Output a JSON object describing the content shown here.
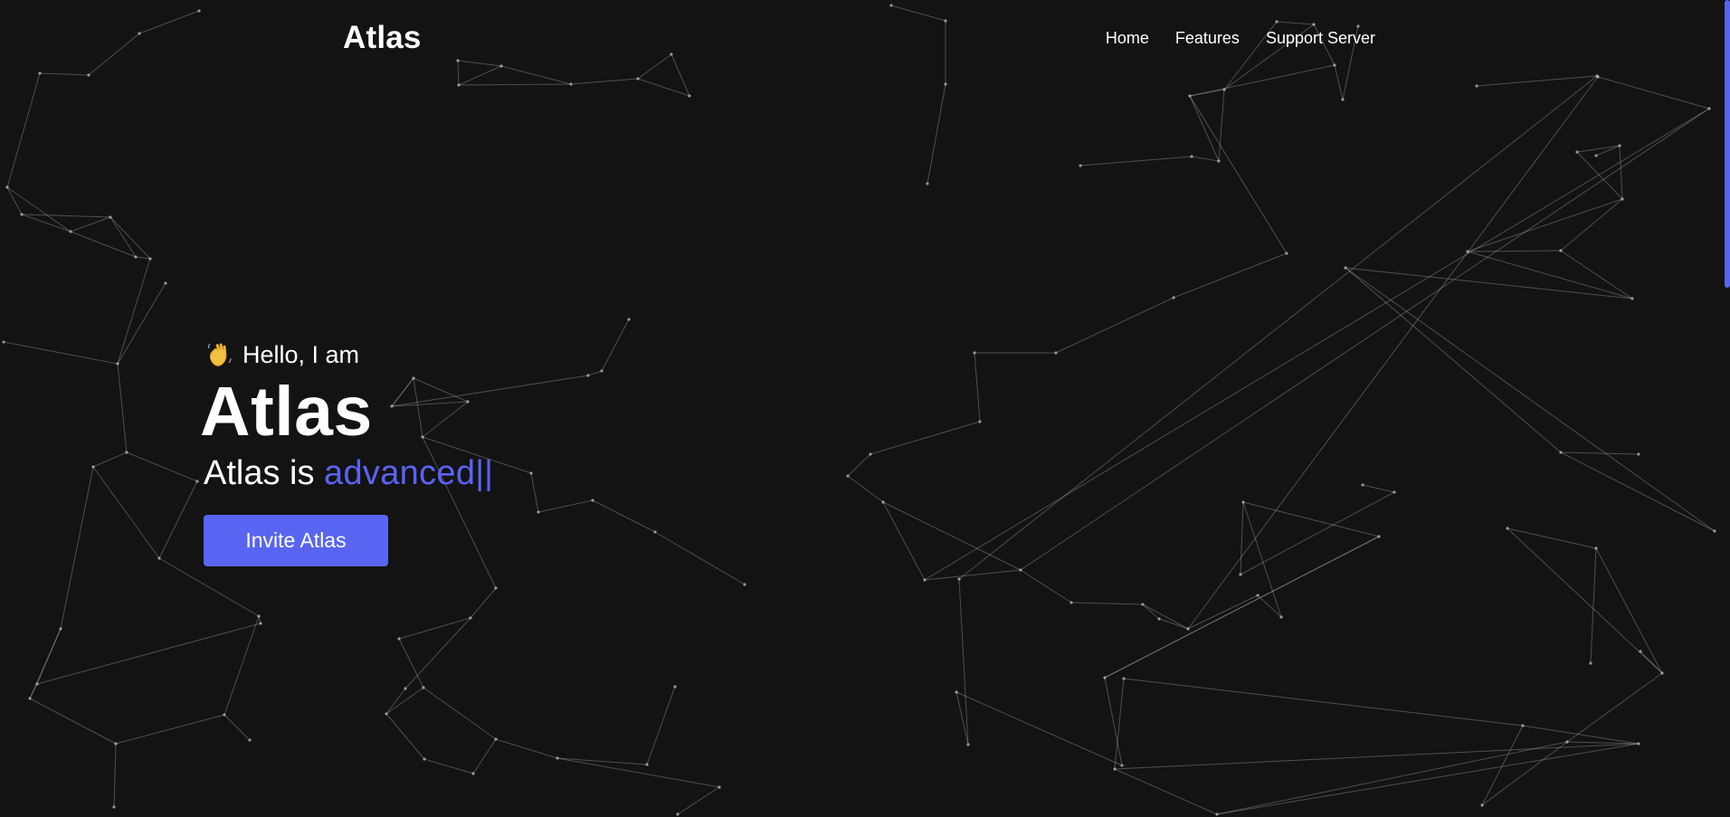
{
  "navbar": {
    "brand": "Atlas",
    "links": [
      "Home",
      "Features",
      "Support Server"
    ]
  },
  "hero": {
    "greeting_emoji": "waving-hand-icon",
    "greeting_text": "Hello, I am",
    "title": "Atlas",
    "tagline_prefix": "Atlas is",
    "tagline_typed_word": "advanced",
    "tagline_cursor": "||",
    "invite_button_label": "Invite Atlas"
  },
  "colors": {
    "background": "#131313",
    "accent": "#5865f2",
    "text": "#ffffff"
  }
}
